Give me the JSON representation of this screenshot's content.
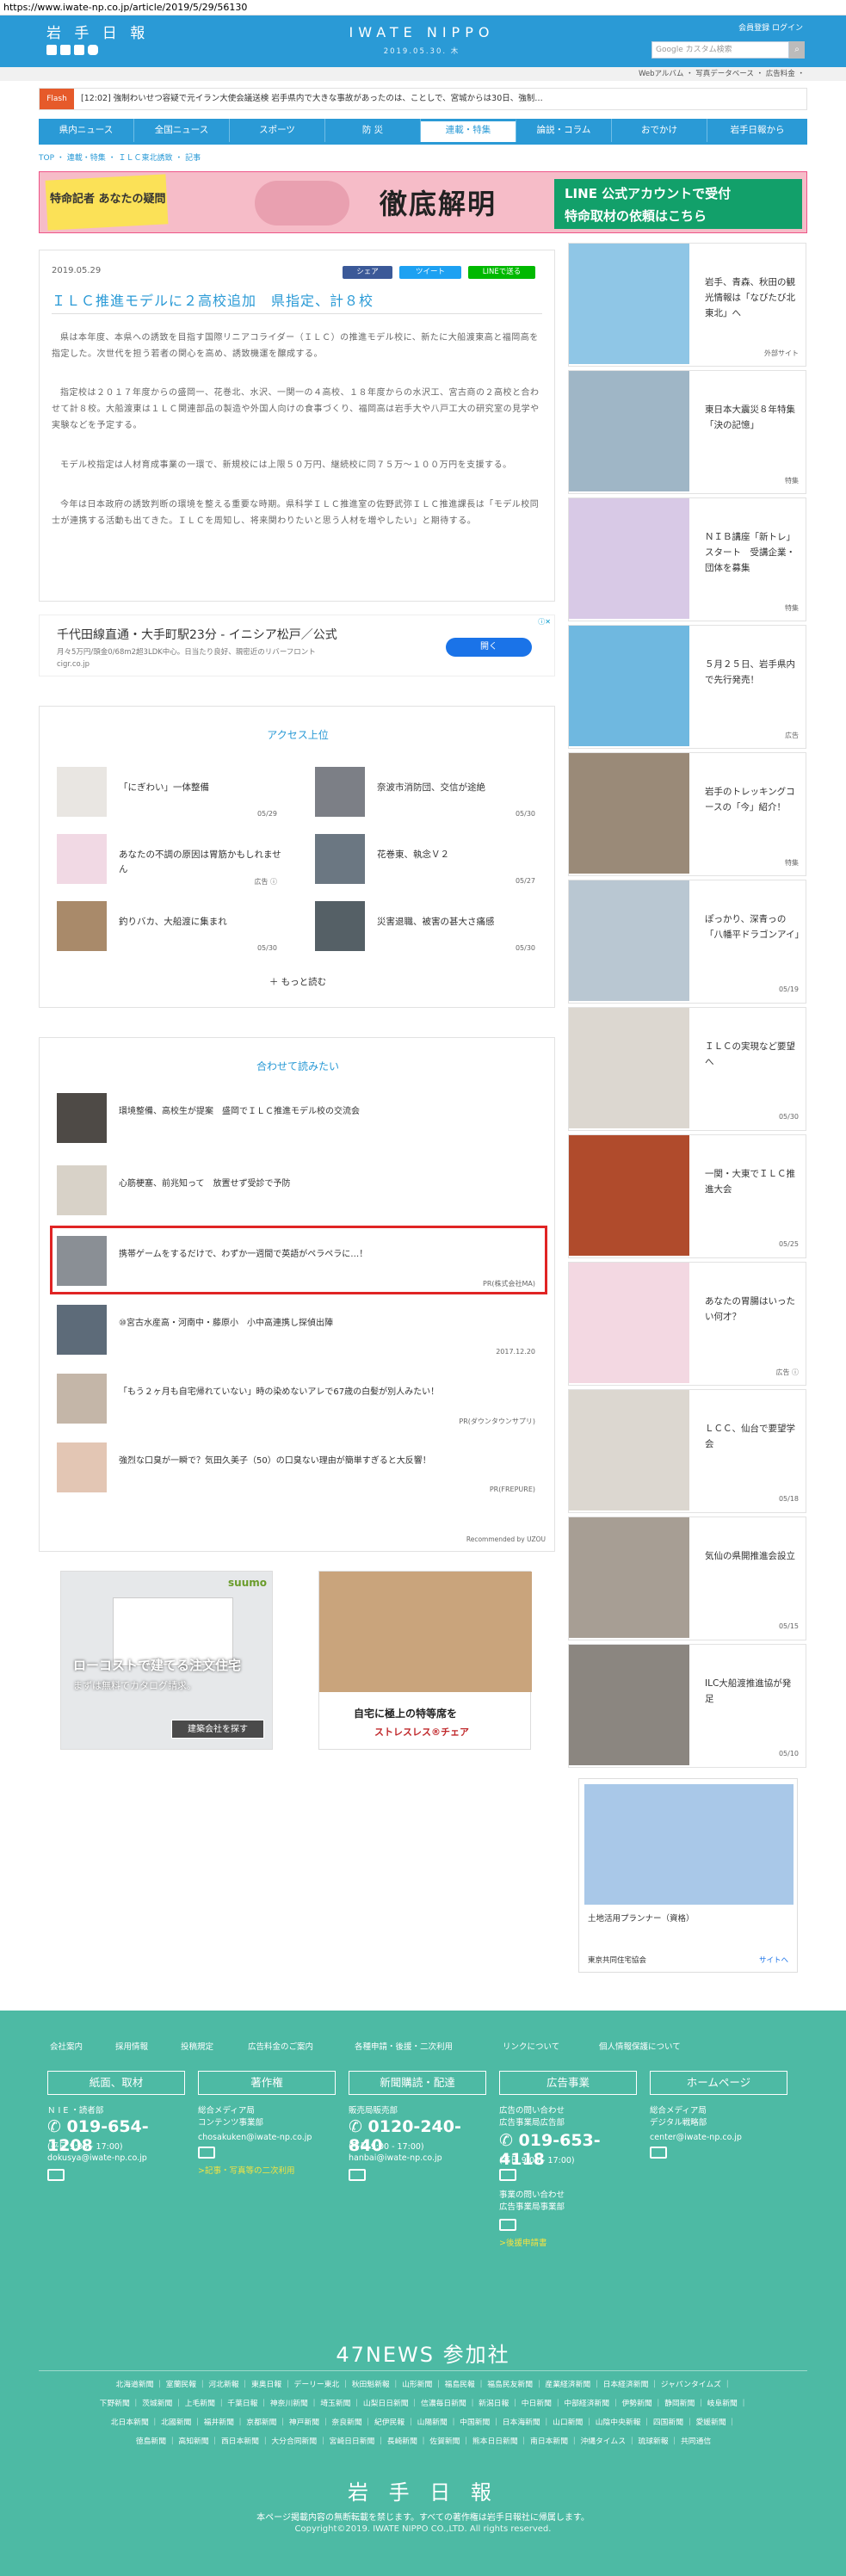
{
  "url": "https://www.iwate-np.co.jp/article/2019/5/29/56130",
  "header": {
    "logo": "岩 手 日 報",
    "masthead": "IWATE NIPPO",
    "date": "2019.05.30. 木",
    "links": "会員登録  ログイン",
    "search_placeholder": "Google カスタム検索",
    "subbar": "Webアルバム ・ 写真データベース ・ 広告料金 ・"
  },
  "flash": {
    "label": "Flash",
    "text": "[12:02] 強制わいせつ容疑で元イラン大使会議送検  岩手県内で大きな事故があったのは、ことしで、宮城からは30日、強制…"
  },
  "nav": [
    "県内ニュース",
    "全国ニュース",
    "スポーツ",
    "防 災",
    "連載・特集",
    "論説・コラム",
    "おでかけ",
    "岩手日報から"
  ],
  "breadcrumb": "TOP ・ 連載・特集 ・ ＩＬＣ東北誘致 ・ 記事",
  "banner": {
    "left": "特命記者 あなたの疑問",
    "middle": "徹底解明",
    "right_line1": "LINE 公式アカウントで受付",
    "right_line2": "特命取材の依頼はこちら"
  },
  "article": {
    "date": "2019.05.29",
    "share_fb": "シェア",
    "share_tw": "ツイート",
    "share_line": "LINEで送る",
    "title": "ＩＬＣ推進モデルに２高校追加　県指定、計８校",
    "paragraphs": [
      "県は本年度、本県への誘致を目指す国際リニアコライダー（ＩＬＣ）の推進モデル校に、新たに大船渡東高と福岡高を指定した。次世代を担う若者の関心を高め、誘致機運を醸成する。",
      "指定校は２０１７年度からの盛岡一、花巻北、水沢、一関一の４高校、１８年度からの水沢工、宮古商の２高校と合わせて計８校。大船渡東は１ＬＣ関連部品の製造や外国人向けの食事づくり、福岡高は岩手大や八戸工大の研究室の見学や実験などを予定する。",
      "モデル校指定は人材育成事業の一環で、新規校には上限５０万円、継続校に同７５万～１００万円を支援する。",
      "今年は日本政府の誘致判断の環境を整える重要な時期。県科学ＩＬＣ推進室の佐野武弥ＩＬＣ推進課長は「モデル校同士が連携する活動も出てきた。ＩＬＣを周知し、将来関わりたいと思う人材を増やしたい」と期待する。"
    ]
  },
  "ad_long": {
    "title": "千代田線直通・大手町駅23分 - イニシア松戸／公式",
    "sub": "月々5万円/頭金0/68m2超3LDK中心。日当たり良好、親密近のリバーフロント",
    "url": "cigr.co.jp",
    "button": "開く"
  },
  "ranking": {
    "title": "アクセス上位",
    "items": [
      {
        "text": "「にぎわい」一体整備",
        "date": "05/29"
      },
      {
        "text": "奈波市消防団、交信が途絶",
        "date": "05/30"
      },
      {
        "text": "あなたの不調の原因は胃筋かもしれません",
        "date": "広告 ⓘ"
      },
      {
        "text": "花巻東、執念Ｖ２",
        "date": "05/27"
      },
      {
        "text": "釣りバカ、大船渡に集まれ",
        "date": "05/30"
      },
      {
        "text": "災害退職、被害の甚大さ痛感",
        "date": "05/30"
      }
    ],
    "more": "もっと読む"
  },
  "recommend": {
    "title": "合わせて読みたい",
    "items": [
      {
        "text": "環境整備、高校生が提案　盛岡でＩＬＣ推進モデル校の交流会",
        "meta": ""
      },
      {
        "text": "心筋梗塞、前兆知って　放置せず受診で予防",
        "meta": ""
      },
      {
        "text": "携帯ゲームをするだけで、わずか一週間で英語がペラペラに…！",
        "meta": "PR(株式会社MA)"
      },
      {
        "text": "⑩宮古水産高・河南中・藤原小　小中高連携し探偵出陣",
        "meta": "2017.12.20"
      },
      {
        "text": "「もう２ヶ月も自宅帰れていない」時の染めないアレで67歳の白髪が別人みたい！",
        "meta": "PR(ダウンタウンサプリ)"
      },
      {
        "text": "強烈な口臭が一瞬で？気田久美子（50）の口臭ない理由が簡単すぎると大反響！",
        "meta": "PR(FREPURE)"
      }
    ],
    "footer": "Recommended by UZOU"
  },
  "bottom_ads": {
    "left_line1": "ローコストで建てる注文住宅",
    "left_line2": "まずは無料でカタログ請求。",
    "left_button": "建築会社を探す",
    "left_brand": "suumo",
    "right_line1": "自宅に極上の特等席を",
    "right_line2": "ストレスレス®チェア"
  },
  "sidebar": [
    {
      "text": "岩手、青森、秋田の観光情報は「なびたび北東北」へ",
      "meta": "外部サイト"
    },
    {
      "text": "東日本大震災８年特集「決の記憶」",
      "meta": "特集"
    },
    {
      "text": "ＮＩＢ講座「新トレ」スタート　受講企業・団体を募集",
      "meta": "特集"
    },
    {
      "text": "５月２５日、岩手県内で先行発売！",
      "meta": "広告"
    },
    {
      "text": "岩手のトレッキングコースの「今」紹介！",
      "meta": "特集"
    },
    {
      "text": "ぽっかり、深青っの「八幡平ドラゴンアイ」",
      "meta": "05/19"
    },
    {
      "text": "ＩＬＣの実現など要望へ",
      "meta": "05/30"
    },
    {
      "text": "一関・大東でＩＬＣ推進大会",
      "meta": "05/25"
    },
    {
      "text": "あなたの胃腸はいったい何才？",
      "meta": "広告 ⓘ"
    },
    {
      "text": "ＬＣＣ、仙台で要望学会",
      "meta": "05/18"
    },
    {
      "text": "気仙の県開推進会設立",
      "meta": "05/15"
    },
    {
      "text": "ILC大船渡推進協が発足",
      "meta": "05/10"
    }
  ],
  "side_ad": {
    "title": "土地活用プランナー（資格）",
    "org": "東京共同住宅協会",
    "link": "サイトへ"
  },
  "footer": {
    "links": [
      "会社案内",
      "採用情報",
      "投稿規定",
      "広告料金のご案内",
      "各種申請・後援・二次利用",
      "リンクについて",
      "個人情報保護について"
    ],
    "cols": [
      {
        "title": "紙面、取材",
        "org": "Ｎ I E ・読者部",
        "phone": "019-654-1208",
        "hours": "(平日 9:00 - 17:00)",
        "mail": "dokusya@iwate-np.co.jp",
        "extra": ""
      },
      {
        "title": "著作権",
        "org": "総合メディア局\nコンテンツ事業部",
        "phone": "",
        "hours": "",
        "mail": "chosakuken@iwate-np.co.jp",
        "extra": ">記事・写真等の二次利用"
      },
      {
        "title": "新聞購読・配達",
        "org": "販売局販売部",
        "phone": "0120-240-840",
        "hours": "(平日 9:00 - 17:00)",
        "mail": "hanbai@iwate-np.co.jp",
        "extra": ""
      },
      {
        "title": "広告事業",
        "org": "広告の問い合わせ\n広告事業局広告部",
        "phone": "019-653-4118",
        "hours": "(平日 9:00 - 17:00)",
        "mail": "事業の問い合わせ\n広告事業局事業部",
        "extra": ">後援申請書"
      },
      {
        "title": "ホームページ",
        "org": "総合メディア局\nデジタル戦略部",
        "phone": "",
        "hours": "",
        "mail": "center@iwate-np.co.jp",
        "extra": ""
      }
    ],
    "news47": "47NEWS 参加社",
    "papers": [
      "北海道新聞 ｜ 室蘭民報 ｜ 河北新報 ｜ 東奥日報 ｜ デーリー東北 ｜ 秋田魁新報 ｜ 山形新聞 ｜ 福島民報 ｜ 福島民友新聞 ｜ 産業経済新聞 ｜ 日本経済新聞 ｜ ジャパンタイムズ ｜",
      "下野新聞 ｜ 茨城新聞 ｜ 上毛新聞 ｜ 千葉日報 ｜ 神奈川新聞 ｜ 埼玉新聞 ｜ 山梨日日新聞 ｜ 信濃毎日新聞 ｜ 新潟日報 ｜ 中日新聞 ｜ 中部経済新聞 ｜ 伊勢新聞 ｜ 静岡新聞 ｜ 岐阜新聞 ｜",
      "北日本新聞 ｜ 北國新聞 ｜ 福井新聞 ｜ 京都新聞 ｜ 神戸新聞 ｜ 奈良新聞 ｜ 紀伊民報 ｜ 山陽新聞 ｜ 中国新聞 ｜ 日本海新聞 ｜ 山口新聞 ｜ 山陰中央新報 ｜ 四国新聞 ｜ 愛媛新聞 ｜",
      "徳島新聞 ｜ 高知新聞 ｜ 西日本新聞 ｜ 大分合同新聞 ｜ 宮崎日日新聞 ｜ 長崎新聞 ｜ 佐賀新聞 ｜ 熊本日日新聞 ｜ 南日本新聞 ｜ 沖縄タイムス ｜ 琉球新報 ｜ 共同通信"
    ],
    "logo": "岩 手 日 報",
    "note": "本ページ掲載内容の無断転載を禁じます。すべての著作権は岩手日報社に帰属します。",
    "copyright": "Copyright©2019. IWATE NIPPO CO.,LTD. All rights reserved."
  }
}
